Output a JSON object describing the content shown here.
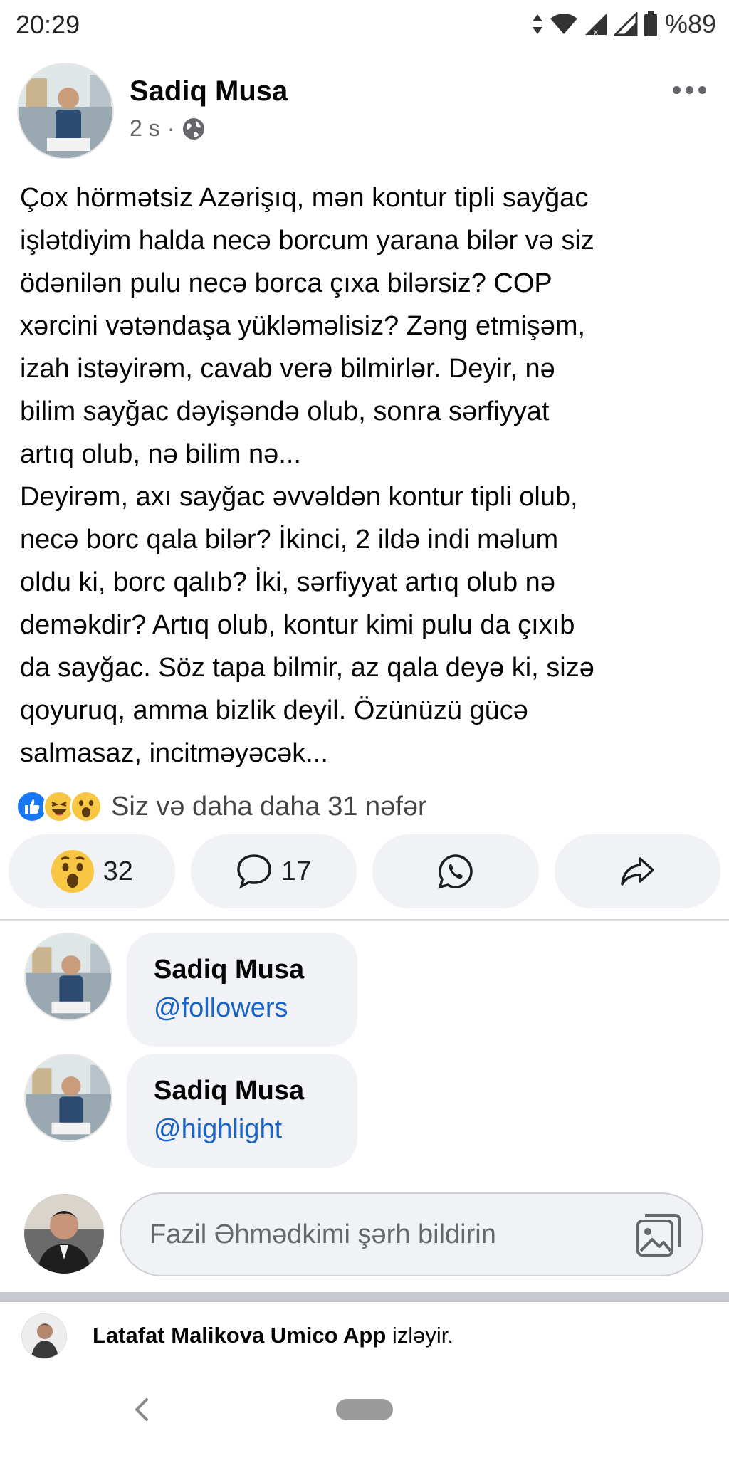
{
  "status_bar": {
    "time": "20:29",
    "battery": "%89"
  },
  "post": {
    "author": "Sadiq Musa",
    "time": "2 s",
    "separator": "·",
    "privacy_icon": "globe-icon",
    "text": "Çox hörmətsiz Azərişıq, mən kontur tipli sayğac\nişlətdiyim halda necə borcum yarana bilər və siz\nödənilən pulu necə borca çıxa bilərsiz? COP\nxərcini vətəndaşa yükləməlisiz? Zəng etmişəm,\nizah istəyirəm, cavab verə bilmirlər. Deyir, nə\nbilim sayğac dəyişəndə olub, sonra sərfiyyat\nartıq olub, nə bilim nə...\nDeyirəm, axı sayğac əvvəldən kontur tipli olub,\nnecə borc qala bilər? İkinci, 2 ildə indi məlum\noldu ki, borc qalıb? İki, sərfiyyat artıq olub nə\ndeməkdir? Artıq olub, kontur kimi pulu da çıxıb\nda sayğac. Söz tapa bilmir, az qala deyə ki, sizə\nqoyuruq, amma bizlik deyil. Özünüzü gücə\nsalmasaz, incitməyəcək..."
  },
  "reactions": {
    "summary": "Siz və daha daha 31 nəfər",
    "icons": [
      "like-icon",
      "haha-icon",
      "wow-icon"
    ]
  },
  "actions": {
    "reaction_count": "32",
    "comment_count": "17"
  },
  "comments": [
    {
      "name": "Sadiq Musa",
      "text": "@followers"
    },
    {
      "name": "Sadiq Musa",
      "text": "@highlight"
    }
  ],
  "composer": {
    "placeholder": "Fazil Əhmədkimi şərh bildirin"
  },
  "follow_notice": {
    "name": "Latafat Malikova Umico App",
    "suffix": " izləyir."
  },
  "colors": {
    "link": "#1a64c7",
    "bubble": "#f0f2f5",
    "like_blue": "#1877f2",
    "reaction_yellow": "#f7c744"
  }
}
